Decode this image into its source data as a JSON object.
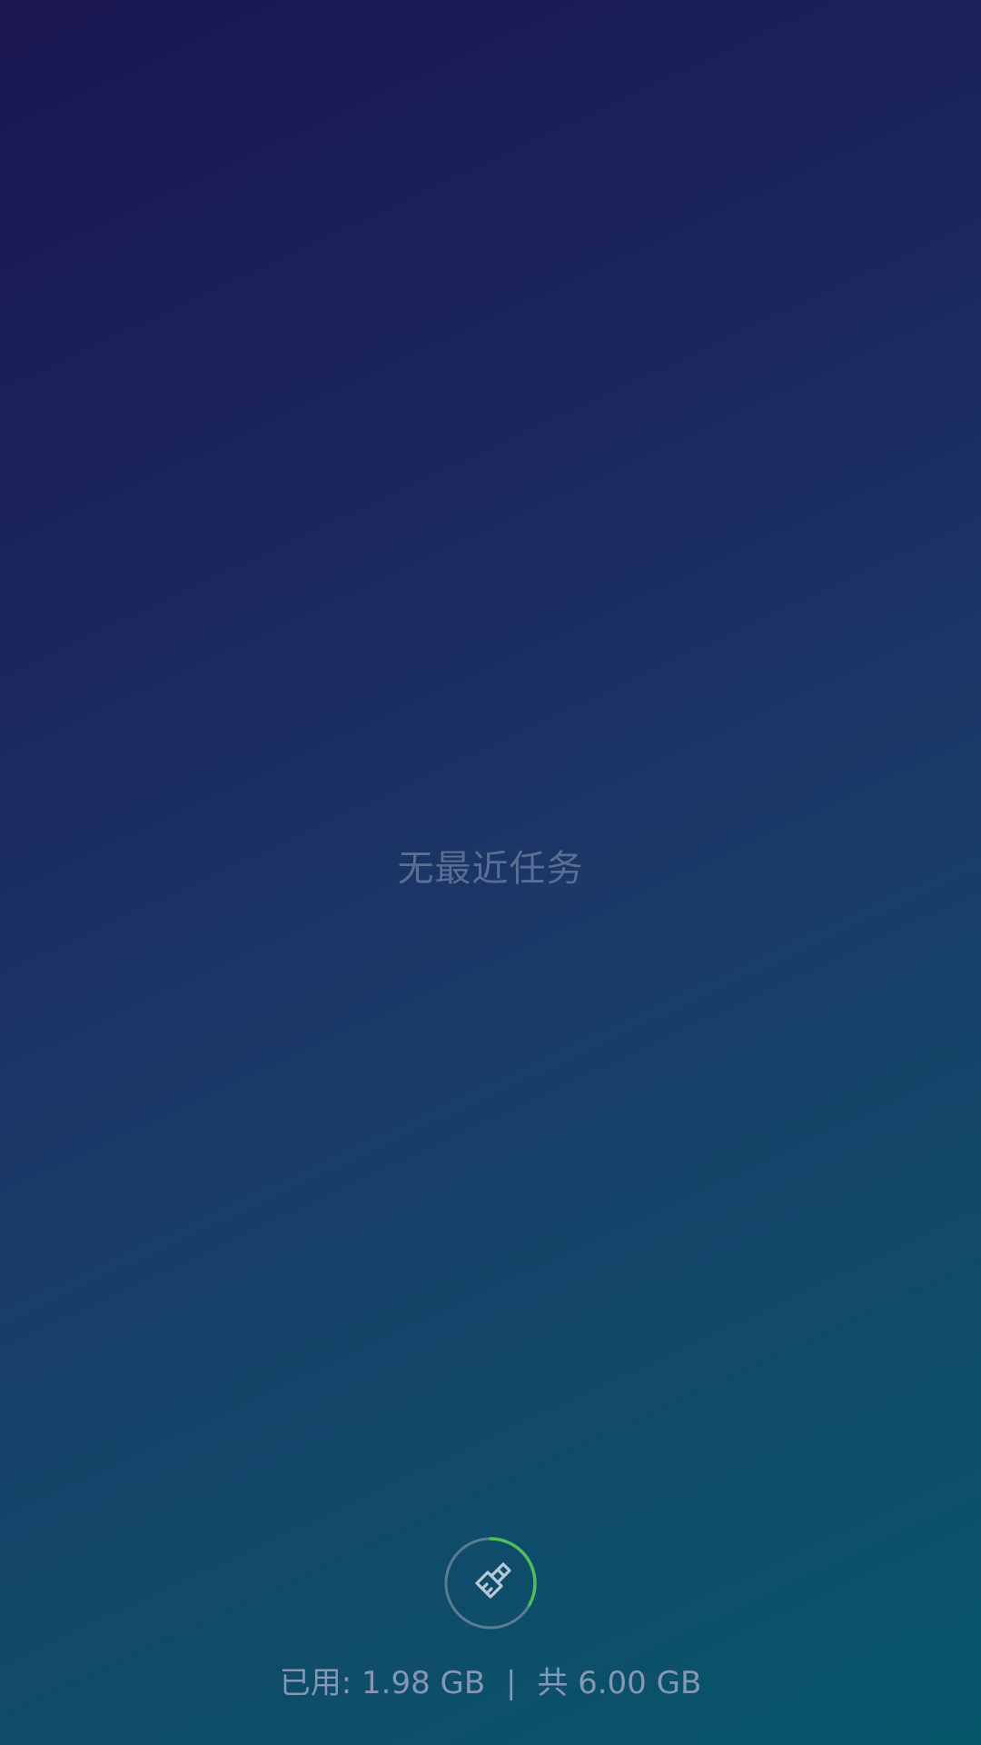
{
  "recents": {
    "empty_text": "无最近任务"
  },
  "memory": {
    "used_label": "已用:",
    "used_value": "1.98 GB",
    "separator": "|",
    "total_label": "共",
    "total_value": "6.00 GB",
    "used_fraction": 0.33
  },
  "clean_button": {
    "icon": "broom-icon",
    "ring_color": "#5b7c90",
    "progress_color": "#4cbf56"
  }
}
